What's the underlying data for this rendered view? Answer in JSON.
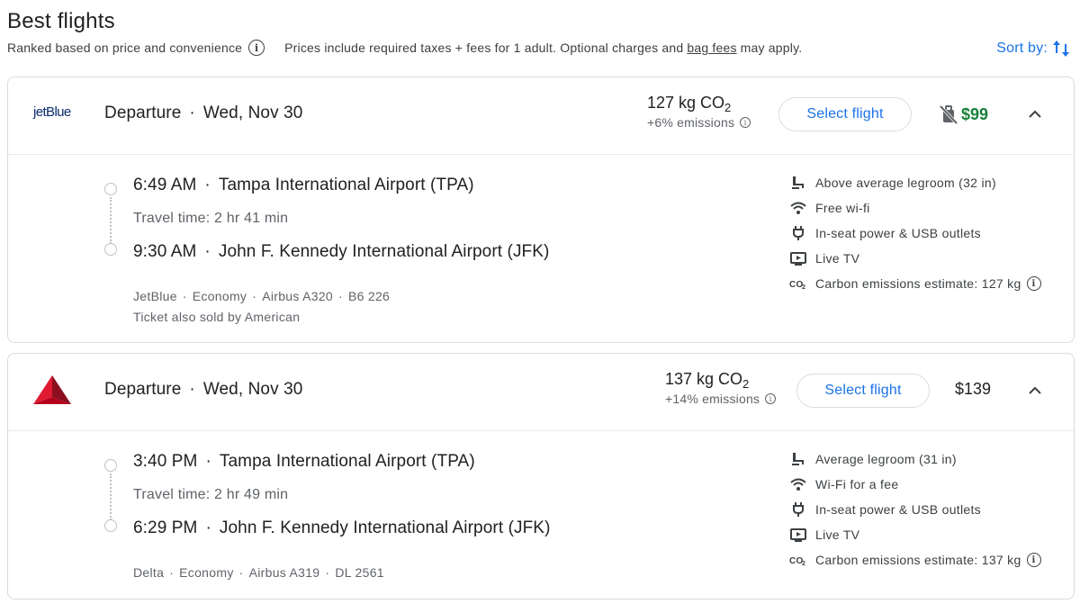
{
  "header": {
    "title": "Best flights",
    "ranked_text": "Ranked based on price and convenience",
    "prices_text_before": "Prices include required taxes + fees for 1 adult. Optional charges and",
    "bag_fees_link": "bag fees",
    "prices_text_after": "may apply.",
    "sort_label": "Sort by:",
    "info_icon": "info-icon",
    "sort_icon": "sort-arrows-icon"
  },
  "flights": [
    {
      "airline_logo": "jetBlue",
      "departure_label": "Departure",
      "date": "Wed, Nov 30",
      "emissions_kg": "127 kg CO",
      "emissions_sub": "2",
      "emissions_pct": "+6% emissions",
      "select_label": "Select flight",
      "price": "$99",
      "price_color": "#188038",
      "price_icon": "no-carry-on-bag-icon",
      "depart_time": "6:49 AM",
      "depart_airport": "Tampa International Airport (TPA)",
      "travel_time": "Travel time: 2 hr 41 min",
      "arrive_time": "9:30 AM",
      "arrive_airport": "John F. Kennedy International Airport (JFK)",
      "meta": [
        "JetBlue",
        "Economy",
        "Airbus A320",
        "B6 226"
      ],
      "sold_by": "Ticket also sold by American",
      "amenities": [
        {
          "icon": "legroom-icon",
          "text": "Above average legroom (32 in)"
        },
        {
          "icon": "wifi-icon",
          "text": "Free wi-fi"
        },
        {
          "icon": "power-plug-icon",
          "text": "In-seat power & USB outlets"
        },
        {
          "icon": "live-tv-icon",
          "text": "Live TV"
        },
        {
          "icon": "co2-icon",
          "text": "Carbon emissions estimate: 127 kg"
        }
      ]
    },
    {
      "airline_logo": "delta-logo",
      "departure_label": "Departure",
      "date": "Wed, Nov 30",
      "emissions_kg": "137 kg CO",
      "emissions_sub": "2",
      "emissions_pct": "+14% emissions",
      "select_label": "Select flight",
      "price": "$139",
      "price_color": "#202124",
      "depart_time": "3:40 PM",
      "depart_airport": "Tampa International Airport (TPA)",
      "travel_time": "Travel time: 2 hr 49 min",
      "arrive_time": "6:29 PM",
      "arrive_airport": "John F. Kennedy International Airport (JFK)",
      "meta": [
        "Delta",
        "Economy",
        "Airbus A319",
        "DL 2561"
      ],
      "amenities": [
        {
          "icon": "legroom-icon",
          "text": "Average legroom (31 in)"
        },
        {
          "icon": "wifi-icon",
          "text": "Wi-Fi for a fee"
        },
        {
          "icon": "power-plug-icon",
          "text": "In-seat power & USB outlets"
        },
        {
          "icon": "live-tv-icon",
          "text": "Live TV"
        },
        {
          "icon": "co2-icon",
          "text": "Carbon emissions estimate: 137 kg"
        }
      ]
    }
  ],
  "colors": {
    "accent": "#1a73e8",
    "price_green": "#188038",
    "delta_red": "#c8102e"
  }
}
